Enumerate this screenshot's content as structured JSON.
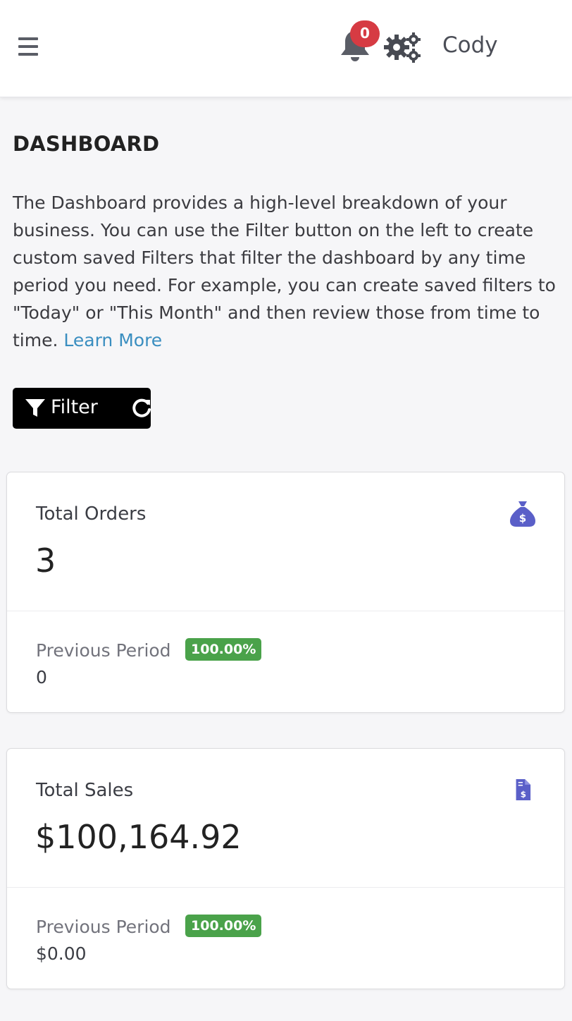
{
  "header": {
    "notification_count": "0",
    "username": "Cody"
  },
  "page": {
    "title": "DASHBOARD",
    "intro_text": "The Dashboard provides a high-level breakdown of your business. You can use the Filter button on the left to create custom saved Filters that filter the dashboard by any time period you need. For example, you can create saved filters to \"Today\" or \"This Month\" and then review those from time to time. ",
    "learn_more_label": "Learn More"
  },
  "toolbar": {
    "filter_label": "Filter"
  },
  "cards": [
    {
      "label": "Total Orders",
      "value": "3",
      "icon": "money-bag-icon",
      "previous_label": "Previous Period",
      "change_badge": "100.00%",
      "previous_value": "0"
    },
    {
      "label": "Total Sales",
      "value": "$100,164.92",
      "icon": "invoice-dollar-icon",
      "previous_label": "Previous Period",
      "change_badge": "100.00%",
      "previous_value": "$0.00"
    }
  ],
  "colors": {
    "accent_icon": "#5a5fc8",
    "badge_red": "#d63b43",
    "badge_green": "#4aa24a",
    "link": "#3a8ec0"
  }
}
